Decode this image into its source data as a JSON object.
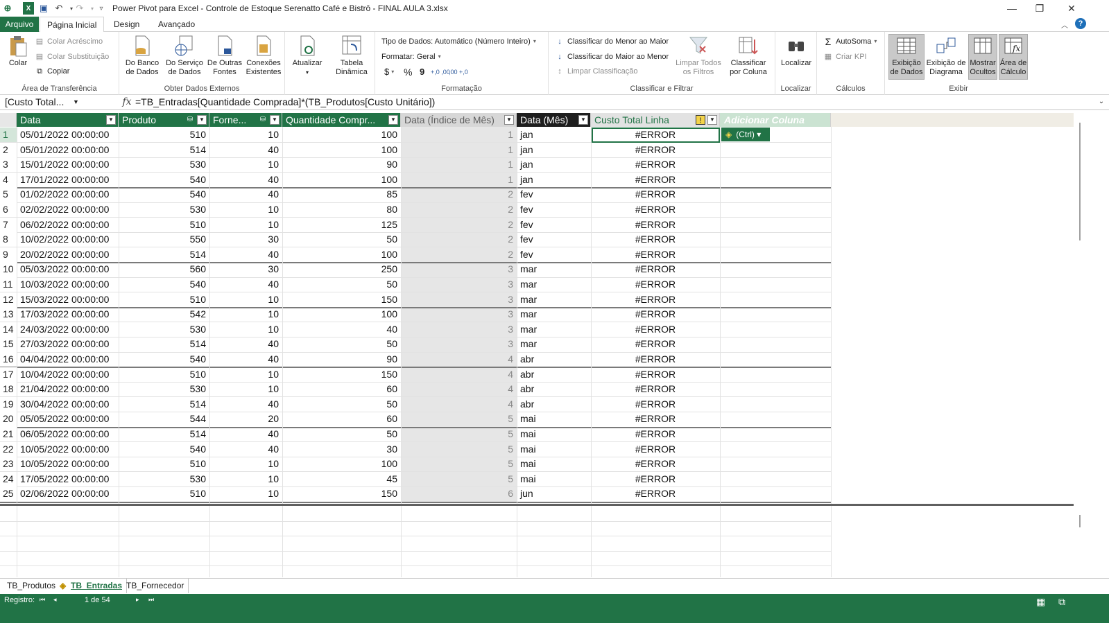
{
  "window": {
    "title": "Power Pivot para Excel - Controle de Estoque Serenatto Café e Bistrô - FINAL AULA 3.xlsx",
    "minimize": "—",
    "restore": "❐",
    "close": "✕"
  },
  "menu": {
    "tabs": [
      "Arquivo",
      "Página Inicial",
      "Design",
      "Avançado"
    ]
  },
  "ribbon": {
    "clipboard": {
      "paste": "Colar",
      "paste_append": "Colar Acréscimo",
      "paste_replace": "Colar Substituição",
      "copy": "Copiar",
      "group": "Área de Transferência"
    },
    "external": {
      "from_db": [
        "Do Banco",
        "de Dados"
      ],
      "from_service": [
        "Do Serviço",
        "de Dados"
      ],
      "from_other": [
        "De Outras",
        "Fontes"
      ],
      "existing": [
        "Conexões",
        "Existentes"
      ],
      "refresh": "Atualizar",
      "pivot": [
        "Tabela",
        "Dinâmica"
      ],
      "group": "Obter Dados Externos"
    },
    "format": {
      "datatype": "Tipo de Dados: Automático (Número Inteiro)",
      "format": "Formatar: Geral",
      "currency": "$",
      "percent": "%",
      "comma": "9",
      "inc_dec": "+,0 ,00",
      "dec_dec": ",00 +,0",
      "group": "Formatação"
    },
    "sort": {
      "asc": "Classificar do Menor ao Maior",
      "desc": "Classificar do Maior ao Menor",
      "clear_sort": "Limpar Classificação",
      "clear_filters": [
        "Limpar Todos",
        "os Filtros"
      ],
      "sort_by_col": [
        "Classificar",
        "por Coluna"
      ],
      "group": "Classificar e Filtrar"
    },
    "find": {
      "find": "Localizar",
      "group": "Localizar"
    },
    "calc": {
      "autosum": "AutoSoma",
      "kpi": "Criar KPI",
      "group": "Cálculos"
    },
    "view": {
      "data_view": [
        "Exibição",
        "de Dados"
      ],
      "diagram_view": [
        "Exibição de",
        "Diagrama"
      ],
      "show_hidden": [
        "Mostrar",
        "Ocultos"
      ],
      "calc_area": [
        "Área de",
        "Cálculo"
      ],
      "group": "Exibir"
    }
  },
  "formula_bar": {
    "name_box": "[Custo Total...",
    "fx": "fx",
    "formula": "=TB_Entradas[Quantidade Comprada]*(TB_Produtos[Custo Unitário])"
  },
  "table": {
    "columns": [
      "Data",
      "Produto",
      "Forne...",
      "Quantidade Compr...",
      "Data (Índice de Mês)",
      "Data (Mês)",
      "Custo Total Linha",
      "Adicionar Coluna"
    ],
    "rows": [
      [
        "1",
        "05/01/2022 00:00:00",
        "510",
        "10",
        "100",
        "1",
        "jan",
        "#ERROR"
      ],
      [
        "2",
        "05/01/2022 00:00:00",
        "514",
        "40",
        "100",
        "1",
        "jan",
        "#ERROR"
      ],
      [
        "3",
        "15/01/2022 00:00:00",
        "530",
        "10",
        "90",
        "1",
        "jan",
        "#ERROR"
      ],
      [
        "4",
        "17/01/2022 00:00:00",
        "540",
        "40",
        "100",
        "1",
        "jan",
        "#ERROR"
      ],
      [
        "5",
        "01/02/2022 00:00:00",
        "540",
        "40",
        "85",
        "2",
        "fev",
        "#ERROR"
      ],
      [
        "6",
        "02/02/2022 00:00:00",
        "530",
        "10",
        "80",
        "2",
        "fev",
        "#ERROR"
      ],
      [
        "7",
        "06/02/2022 00:00:00",
        "510",
        "10",
        "125",
        "2",
        "fev",
        "#ERROR"
      ],
      [
        "8",
        "10/02/2022 00:00:00",
        "550",
        "30",
        "50",
        "2",
        "fev",
        "#ERROR"
      ],
      [
        "9",
        "20/02/2022 00:00:00",
        "514",
        "40",
        "100",
        "2",
        "fev",
        "#ERROR"
      ],
      [
        "10",
        "05/03/2022 00:00:00",
        "560",
        "30",
        "250",
        "3",
        "mar",
        "#ERROR"
      ],
      [
        "11",
        "10/03/2022 00:00:00",
        "540",
        "40",
        "50",
        "3",
        "mar",
        "#ERROR"
      ],
      [
        "12",
        "15/03/2022 00:00:00",
        "510",
        "10",
        "150",
        "3",
        "mar",
        "#ERROR"
      ],
      [
        "13",
        "17/03/2022 00:00:00",
        "542",
        "10",
        "100",
        "3",
        "mar",
        "#ERROR"
      ],
      [
        "14",
        "24/03/2022 00:00:00",
        "530",
        "10",
        "40",
        "3",
        "mar",
        "#ERROR"
      ],
      [
        "15",
        "27/03/2022 00:00:00",
        "514",
        "40",
        "50",
        "3",
        "mar",
        "#ERROR"
      ],
      [
        "16",
        "04/04/2022 00:00:00",
        "540",
        "40",
        "90",
        "4",
        "abr",
        "#ERROR"
      ],
      [
        "17",
        "10/04/2022 00:00:00",
        "510",
        "10",
        "150",
        "4",
        "abr",
        "#ERROR"
      ],
      [
        "18",
        "21/04/2022 00:00:00",
        "530",
        "10",
        "60",
        "4",
        "abr",
        "#ERROR"
      ],
      [
        "19",
        "30/04/2022 00:00:00",
        "514",
        "40",
        "50",
        "4",
        "abr",
        "#ERROR"
      ],
      [
        "20",
        "05/05/2022 00:00:00",
        "544",
        "20",
        "60",
        "5",
        "mai",
        "#ERROR"
      ],
      [
        "21",
        "06/05/2022 00:00:00",
        "514",
        "40",
        "50",
        "5",
        "mai",
        "#ERROR"
      ],
      [
        "22",
        "10/05/2022 00:00:00",
        "540",
        "40",
        "30",
        "5",
        "mai",
        "#ERROR"
      ],
      [
        "23",
        "10/05/2022 00:00:00",
        "510",
        "10",
        "100",
        "5",
        "mai",
        "#ERROR"
      ],
      [
        "24",
        "17/05/2022 00:00:00",
        "530",
        "10",
        "45",
        "5",
        "mai",
        "#ERROR"
      ],
      [
        "25",
        "02/06/2022 00:00:00",
        "510",
        "10",
        "150",
        "6",
        "jun",
        "#ERROR"
      ]
    ],
    "paste_options": "(Ctrl)"
  },
  "sheets": {
    "tabs": [
      "TB_Produtos",
      "TB_Entradas",
      "TB_Fornecedor"
    ],
    "active": 1
  },
  "status": {
    "record_label": "Registro:",
    "record_pos": "1 de 54"
  },
  "colors": {
    "excel_green": "#217346",
    "header_grey": "#d7d7d7",
    "add_column": "#cbe3d2"
  }
}
